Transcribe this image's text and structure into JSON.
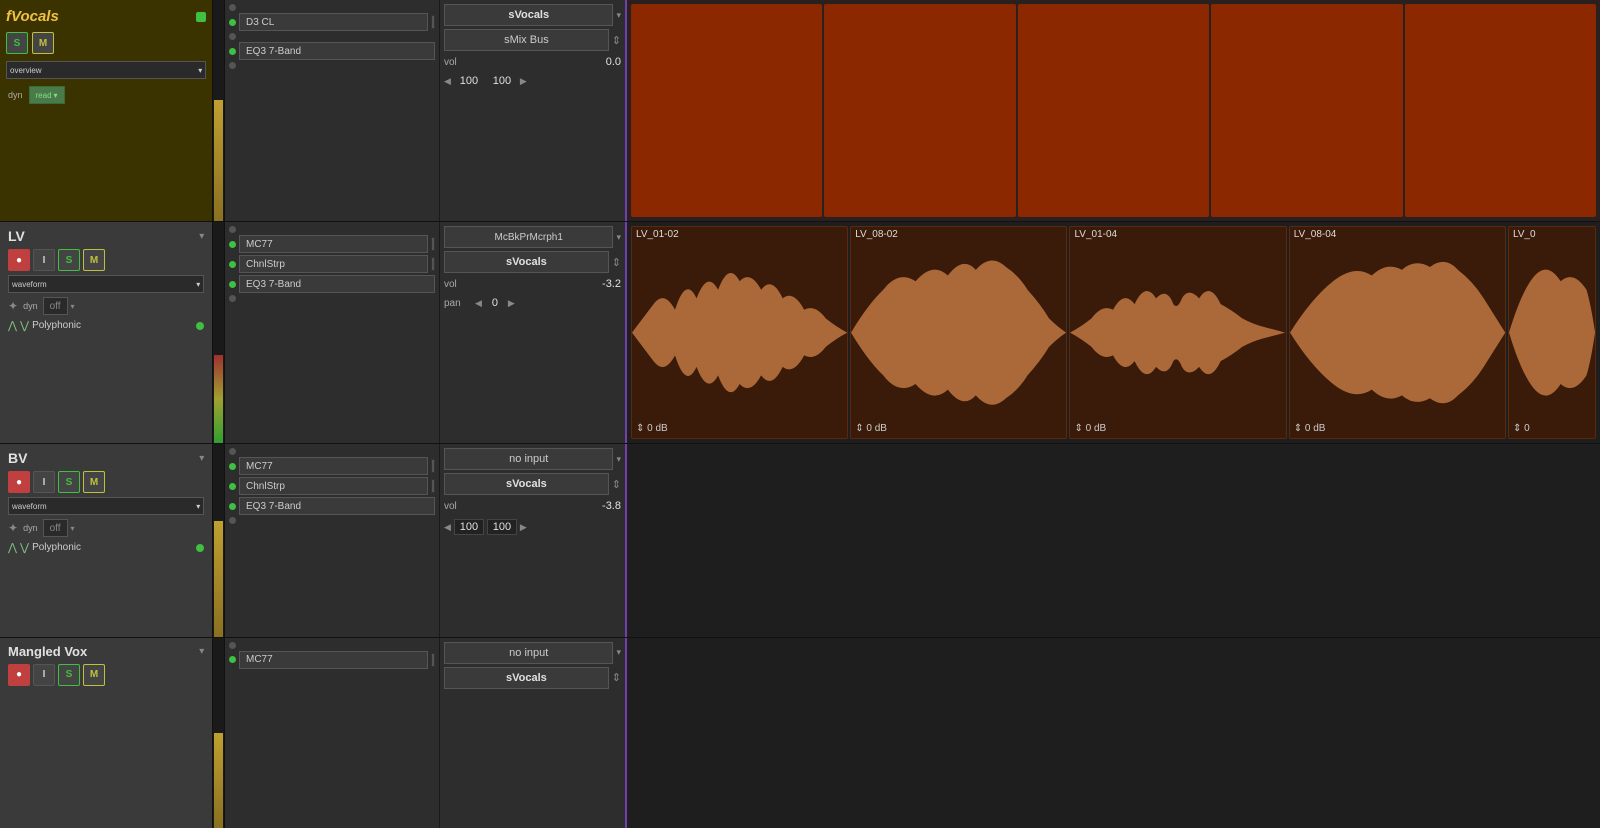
{
  "tracks": {
    "fvocals": {
      "title": "fVocals",
      "s_label": "S",
      "m_label": "M",
      "overview_label": "overview",
      "dyn_label": "dyn",
      "read_label": "read",
      "plugin1": "D3 CL",
      "plugin2": "EQ3 7-Band",
      "bus_label": "sVocals",
      "smix_label": "sMix Bus",
      "vol_label": "vol",
      "vol_value": "0.0"
    },
    "lv": {
      "title": "LV",
      "rec_label": "●",
      "i_label": "I",
      "s_label": "S",
      "m_label": "M",
      "waveform_label": "waveform",
      "dyn_label": "dyn",
      "off_label": "off",
      "polyphonic_label": "Polyphonic",
      "plugin1": "MC77",
      "plugin2": "ChnlStrp",
      "plugin3": "EQ3 7-Band",
      "input_label": "McBkPrMcrph1",
      "bus_label": "sVocals",
      "vol_label": "vol",
      "vol_value": "-3.2",
      "pan_label": "pan",
      "pan_value": "0",
      "clips": [
        {
          "label": "LV_01-02",
          "db": "0 dB"
        },
        {
          "label": "LV_08-02",
          "db": "0 dB"
        },
        {
          "label": "LV_01-04",
          "db": "0 dB"
        },
        {
          "label": "LV_08-04",
          "db": "0 dB"
        },
        {
          "label": "LV_0",
          "db": "0"
        }
      ]
    },
    "bv": {
      "title": "BV",
      "rec_label": "●",
      "i_label": "I",
      "s_label": "S",
      "m_label": "M",
      "waveform_label": "waveform",
      "dyn_label": "dyn",
      "off_label": "off",
      "polyphonic_label": "Polyphonic",
      "plugin1": "MC77",
      "plugin2": "ChnlStrp",
      "plugin3": "EQ3 7-Band",
      "input_label": "no input",
      "bus_label": "sVocals",
      "vol_label": "vol",
      "vol_value": "-3.8",
      "pan_left": "100",
      "pan_right": "100"
    },
    "mangled": {
      "title": "Mangled Vox",
      "rec_label": "●",
      "i_label": "I",
      "s_label": "S",
      "m_label": "M",
      "plugin1": "MC77",
      "input_label": "no input",
      "bus_label": "sVocals"
    }
  },
  "icons": {
    "dropdown_arrow": "▾",
    "arrow_left": "◀",
    "arrow_right": "▶",
    "send_arrow": "⇕",
    "star": "✦",
    "pitch1": "⋀",
    "pitch2": "⋁"
  }
}
